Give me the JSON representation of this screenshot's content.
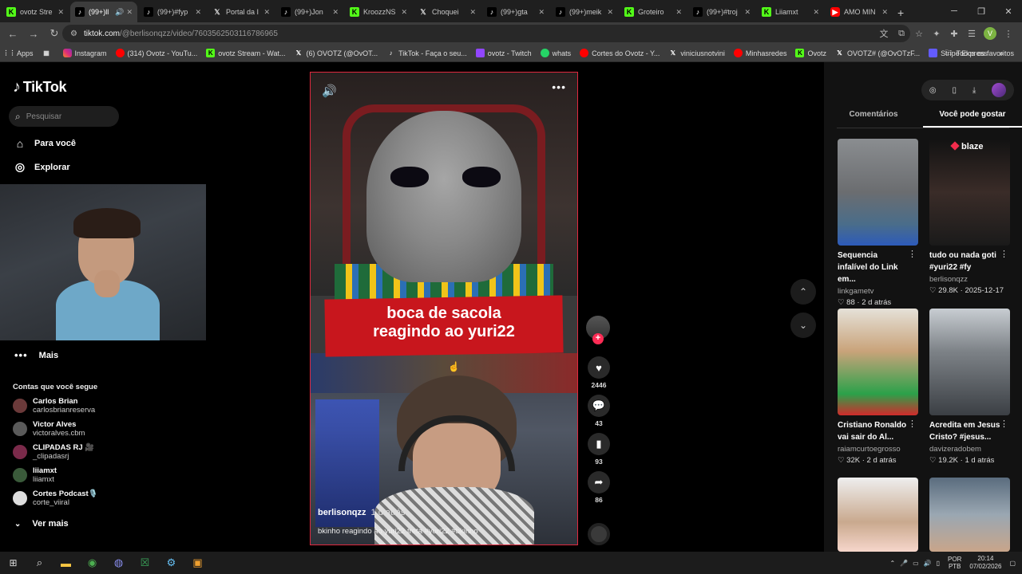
{
  "browser": {
    "tabs": [
      {
        "title": "ovotz Stre",
        "icon": "kick",
        "active": false
      },
      {
        "title": "(99+)ll",
        "icon": "tiktok",
        "active": true
      },
      {
        "title": "(99+)#fyp",
        "icon": "tiktok",
        "active": false
      },
      {
        "title": "Portal da I",
        "icon": "x",
        "active": false
      },
      {
        "title": "(99+)Jon",
        "icon": "tiktok",
        "active": false
      },
      {
        "title": "KroozzNS",
        "icon": "kick",
        "active": false
      },
      {
        "title": "Choquei",
        "icon": "x",
        "active": false
      },
      {
        "title": "(99+)gta",
        "icon": "tiktok",
        "active": false
      },
      {
        "title": "(99+)meik",
        "icon": "tiktok",
        "active": false
      },
      {
        "title": "Groteiro",
        "icon": "kick",
        "active": false
      },
      {
        "title": "(99+)#troj",
        "icon": "tiktok",
        "active": false
      },
      {
        "title": "Liiamxt",
        "icon": "kick",
        "active": false
      },
      {
        "title": "AMO MIN",
        "icon": "youtube",
        "active": false
      }
    ],
    "url_host": "tiktok.com",
    "url_path": "/@berlisonqzz/video/7603562503116786965",
    "bookmarks": [
      {
        "label": "Apps",
        "icon": "apps"
      },
      {
        "label": "",
        "icon": "grid"
      },
      {
        "label": "Instagram",
        "icon": "instagram"
      },
      {
        "label": "(314) Ovotz - YouTu...",
        "icon": "youtube"
      },
      {
        "label": "ovotz Stream - Wat...",
        "icon": "kick"
      },
      {
        "label": "(6) OVOTZ (@OvOT...",
        "icon": "x"
      },
      {
        "label": "TikTok - Faça o seu...",
        "icon": "tiktok"
      },
      {
        "label": "ovotz - Twitch",
        "icon": "twitch"
      },
      {
        "label": "whats",
        "icon": "whatsapp"
      },
      {
        "label": "Cortes do Ovotz - Y...",
        "icon": "youtube"
      },
      {
        "label": "viniciusnotvini",
        "icon": "x"
      },
      {
        "label": "Minhasredes",
        "icon": "youtube"
      },
      {
        "label": "Ovotz",
        "icon": "kick"
      },
      {
        "label": "OVOTZ# (@OvOTzF...",
        "icon": "x"
      },
      {
        "label": "Stripe Express",
        "icon": "stripe"
      }
    ],
    "all_bookmarks_label": "Todos os favoritos",
    "profile_initial": "V"
  },
  "sidebar": {
    "logo": "TikTok",
    "search_placeholder": "Pesquisar",
    "nav": [
      {
        "label": "Para você",
        "icon": "home-icon"
      },
      {
        "label": "Explorar",
        "icon": "compass-icon"
      }
    ],
    "more_label": "Mais",
    "following_title": "Contas que você segue",
    "accounts": [
      {
        "name": "Carlos Brian",
        "handle": "carlosbrianreserva"
      },
      {
        "name": "Victor Alves",
        "handle": "victoralves.cbm"
      },
      {
        "name": "CLIPADAS RJ 🎥",
        "handle": "_clipadasrj"
      },
      {
        "name": "liiamxt",
        "handle": "liiamxt"
      },
      {
        "name": "Cortes Podcast🎙️",
        "handle": "corte_viiral"
      }
    ],
    "see_more_label": "Ver mais"
  },
  "video": {
    "overlay_caption": "boca de sacola\nreagindo ao yuri22",
    "author": "berlisonqzz",
    "time_ago": "1 d atrás",
    "description": "bkinho reagindo ao yuri22 treta #yuri22 #bkinho",
    "likes": "2446",
    "comments": "43",
    "saves": "93",
    "shares": "86"
  },
  "right_panel": {
    "tabs": [
      "Comentários",
      "Você pode gostar"
    ],
    "active_tab": 1,
    "cards": [
      {
        "title": "Sequencia infalível do Link em...",
        "author": "linkgametv",
        "likes": "88",
        "date": "2 d atrás"
      },
      {
        "title": "tudo ou nada goti #yuri22 #fy",
        "author": "berlisonqzz",
        "likes": "29.8K",
        "date": "2025-12-17"
      },
      {
        "title": "Cristiano Ronaldo vai sair do Al...",
        "author": "raiamcurtoegrosso",
        "likes": "32K",
        "date": "2 d atrás"
      },
      {
        "title": "Acredita em Jesus Cristo? #jesus...",
        "author": "davizeradobem",
        "likes": "19.2K",
        "date": "1 d atrás"
      },
      {
        "title": "",
        "author": "",
        "likes": "",
        "date": ""
      },
      {
        "title": "",
        "author": "",
        "likes": "",
        "date": ""
      }
    ],
    "card2_brand": "blaze"
  },
  "taskbar": {
    "lang_line1": "POR",
    "lang_line2": "PTB",
    "time": "20:14",
    "date": "07/02/2026"
  },
  "colors": {
    "accent": "#fe2c55",
    "video_border": "#e0283e",
    "banner": "#c8161d"
  }
}
